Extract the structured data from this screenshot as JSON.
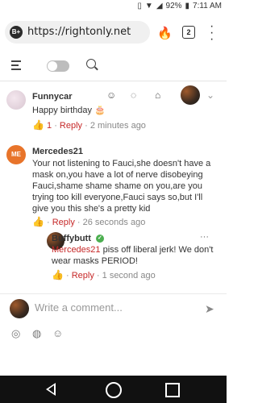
{
  "status": {
    "battery": "92%",
    "time": "7:11 AM"
  },
  "browser": {
    "url": "https://rightonly.net",
    "site_badge": "B+",
    "tab_count": "2"
  },
  "comments": [
    {
      "author": "Funnycar",
      "text": "Happy birthday",
      "likes": "1",
      "reply_label": "Reply",
      "time": "2 minutes ago"
    },
    {
      "author": "Mercedes21",
      "avatar_initials": "ME",
      "text": "Your not listening to Fauci,she doesn't have a mask on,you have a lot of nerve disobeying Fauci,shame shame shame on you,are you trying too kill everyone,Fauci says so,but I'll give you this she's a pretty kid",
      "reply_label": "Reply",
      "time": "26 seconds ago"
    },
    {
      "author": "Buffybutt",
      "mention": "Mercedes21",
      "text": " piss off liberal jerk! We don't wear masks PERIOD!",
      "reply_label": "Reply",
      "time": "1 second ago"
    }
  ],
  "composer": {
    "placeholder": "Write a comment..."
  },
  "colors": {
    "accent": "#c62828",
    "verified": "#4caf50",
    "me_avatar": "#e8742a"
  },
  "icons": [
    "hamburger-menu-icon",
    "toggle-switch",
    "search-icon",
    "fire-icon",
    "tabs-icon",
    "kebab-menu-icon",
    "group-icon",
    "chat-bubble-icon",
    "bell-icon",
    "chevron-down-icon",
    "thumbs-up-icon",
    "camera-icon",
    "gif-icon",
    "emoji-icon",
    "send-icon",
    "cake-icon",
    "verified-icon"
  ]
}
